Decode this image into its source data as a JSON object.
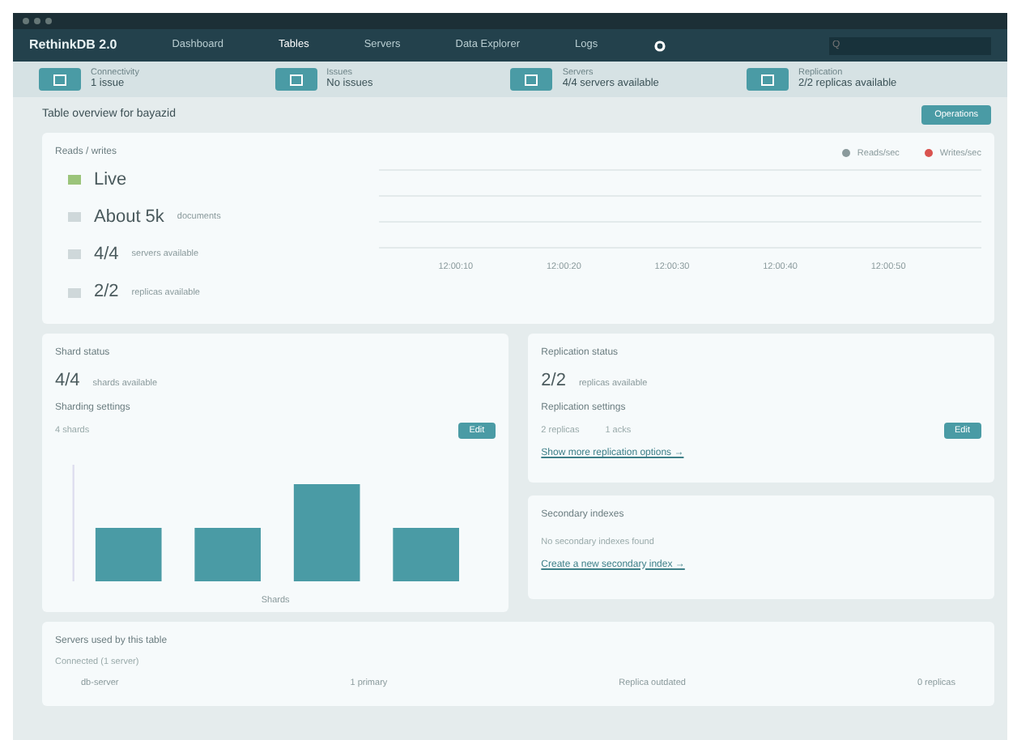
{
  "navbar": {
    "brand": "RethinkDB 2.0",
    "links": [
      {
        "label": "Dashboard",
        "selected": false
      },
      {
        "label": "Tables",
        "selected": true
      },
      {
        "label": "Servers",
        "selected": false
      },
      {
        "label": "Data Explorer",
        "selected": false
      },
      {
        "label": "Logs",
        "selected": false
      }
    ],
    "search": {
      "placeholder": "Q"
    }
  },
  "status_bar": [
    {
      "label": "Connectivity",
      "value": "1 issue"
    },
    {
      "label": "Issues",
      "value": "No issues"
    },
    {
      "label": "Servers",
      "value": "4/4 servers available"
    },
    {
      "label": "Replication",
      "value": "2/2 replicas available"
    }
  ],
  "page_title": "Table overview for bayazid",
  "header_button": "Operations",
  "overview": {
    "title": "Reads / writes",
    "legend": [
      {
        "label": "Reads/sec",
        "color": "#8a9a9c"
      },
      {
        "label": "Writes/sec",
        "color": "#d9534f"
      }
    ],
    "stats": [
      {
        "big": "Live",
        "color": "#9bc47a"
      },
      {
        "big": "About 5k",
        "small": "documents",
        "color": "#cfd8da"
      },
      {
        "big": "4/4",
        "small": "servers available",
        "color": "#cfd8da"
      },
      {
        "big": "2/2",
        "small": "replicas available",
        "color": "#cfd8da"
      }
    ],
    "x_labels": [
      "12:00:10",
      "12:00:20",
      "12:00:30",
      "12:00:40",
      "12:00:50"
    ]
  },
  "shards": {
    "title": "Shard status",
    "big": "4/4",
    "small": "shards available",
    "settings_title": "Sharding settings",
    "settings": [
      "4 shards"
    ],
    "edit": "Edit",
    "axis_label": "Shards"
  },
  "replication": {
    "title": "Replication status",
    "big": "2/2",
    "small": "replicas available",
    "settings_title": "Replication settings",
    "settings": [
      "2 replicas",
      "1 acks"
    ],
    "edit": "Edit",
    "more_link": "Show more replication options →"
  },
  "indexes": {
    "title": "Secondary indexes",
    "empty": "No secondary indexes found",
    "create_link": "Create a new secondary index →"
  },
  "servers": {
    "title": "Servers used by this table",
    "group": "Connected (1 server)",
    "row": [
      "db-server",
      "1 primary",
      "Replica outdated",
      "0 replicas"
    ]
  }
}
